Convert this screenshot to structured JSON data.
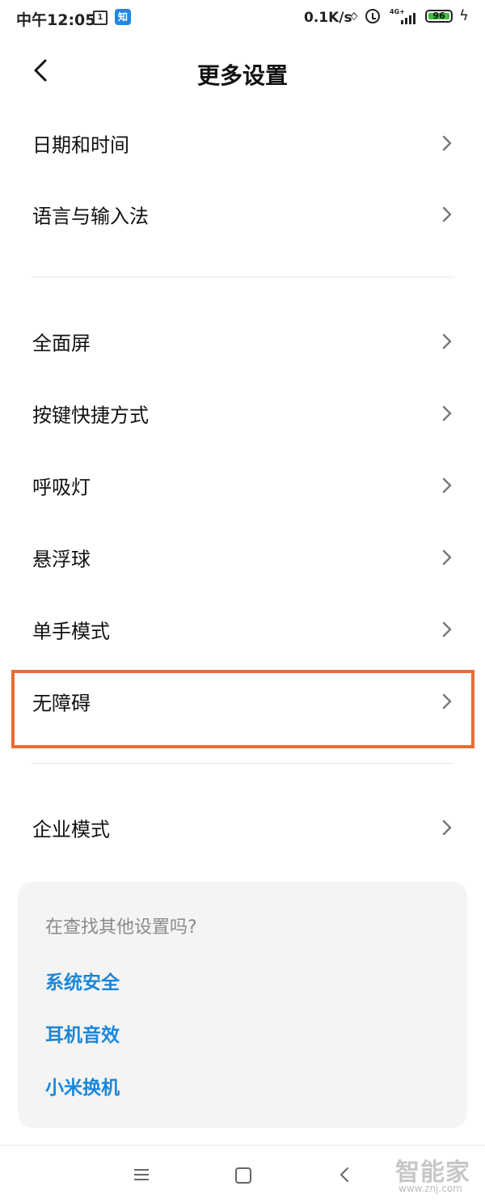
{
  "status_bar": {
    "time": "中午12:05",
    "calendar_badge": "1",
    "zhihu_badge": "知",
    "network_speed": "0.1K/s",
    "signal_label": "4G+",
    "battery": "96",
    "bluetooth_icon": "bluetooth-icon",
    "alarm_icon": "alarm-icon"
  },
  "header": {
    "title": "更多设置",
    "back_icon": "chevron-left-icon"
  },
  "group1": [
    {
      "label": "日期和时间"
    },
    {
      "label": "语言与输入法"
    }
  ],
  "group2": [
    {
      "label": "全面屏"
    },
    {
      "label": "按键快捷方式"
    },
    {
      "label": "呼吸灯"
    },
    {
      "label": "悬浮球"
    },
    {
      "label": "单手模式"
    },
    {
      "label": "无障碍"
    }
  ],
  "group3": [
    {
      "label": "企业模式"
    }
  ],
  "suggestions": {
    "hint": "在查找其他设置吗?",
    "links": [
      "系统安全",
      "耳机音效",
      "小米换机"
    ]
  },
  "watermark": {
    "brand": "智能家",
    "url": "www.znj.com"
  },
  "colors": {
    "highlight": "#e96d35",
    "link": "#1a86d8",
    "battery_fill": "#3bc13b"
  }
}
